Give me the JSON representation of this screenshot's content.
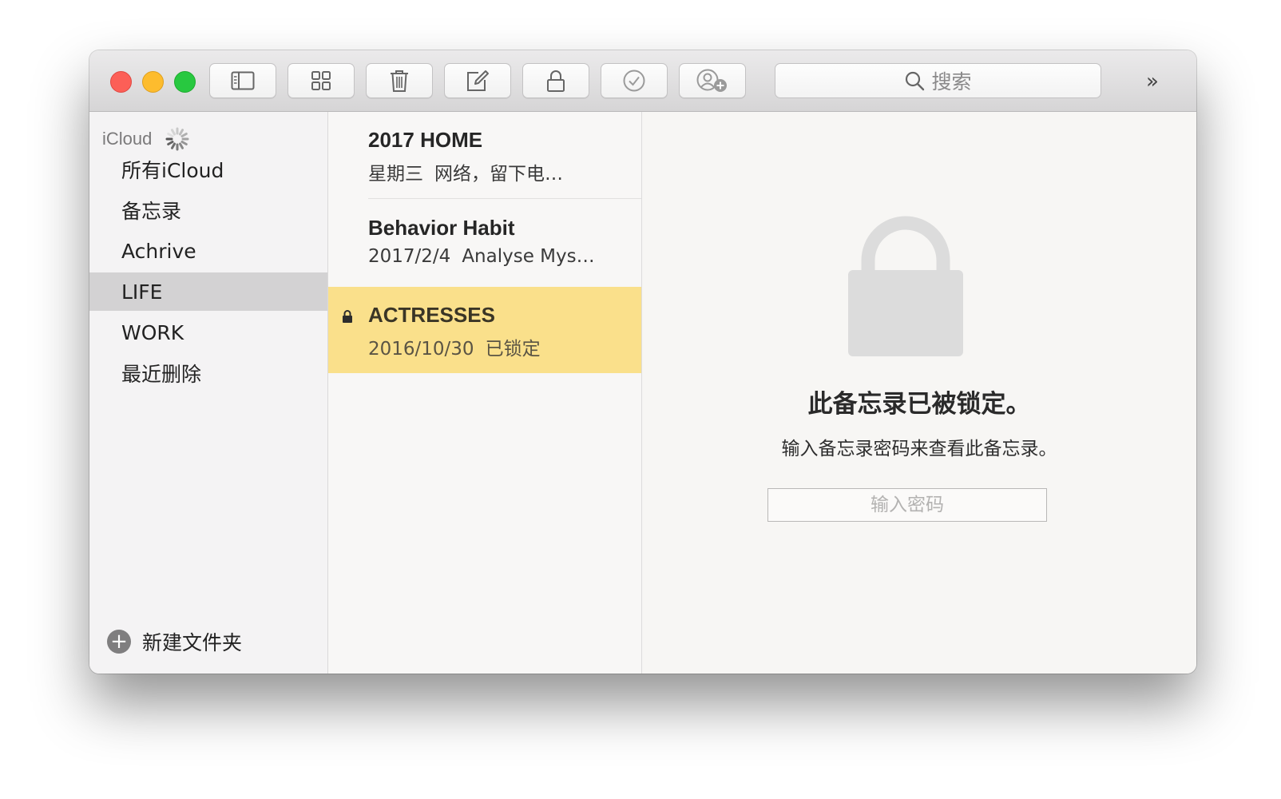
{
  "toolbar": {
    "buttons": [
      {
        "name": "sidebar-toggle",
        "icon": "sidebar-icon"
      },
      {
        "name": "attachments-browser",
        "icon": "grid-icon"
      },
      {
        "name": "delete",
        "icon": "trash-icon"
      },
      {
        "name": "new-note",
        "icon": "compose-icon"
      },
      {
        "name": "lock-note",
        "icon": "lock-icon"
      },
      {
        "name": "checklist",
        "icon": "checkmark-circle-icon"
      },
      {
        "name": "add-people",
        "icon": "add-person-icon"
      }
    ],
    "search_placeholder": "搜索",
    "overflow_label": "»"
  },
  "sidebar": {
    "account": "iCloud",
    "folders": [
      {
        "label": "所有iCloud",
        "selected": false
      },
      {
        "label": "备忘录",
        "selected": false
      },
      {
        "label": "Achrive",
        "selected": false
      },
      {
        "label": "LIFE",
        "selected": true
      },
      {
        "label": "WORK",
        "selected": false
      },
      {
        "label": "最近删除",
        "selected": false
      }
    ],
    "new_folder_label": "新建文件夹"
  },
  "notes": [
    {
      "title": "2017 HOME",
      "date": "星期三",
      "preview": "网络，留下电…",
      "locked": false,
      "selected": false
    },
    {
      "title": "Behavior Habit",
      "date": "2017/2/4",
      "preview": "Analyse Mys…",
      "locked": false,
      "selected": false
    },
    {
      "title": "ACTRESSES",
      "date": "2016/10/30",
      "preview": "已锁定",
      "locked": true,
      "selected": true
    }
  ],
  "detail": {
    "locked_title": "此备忘录已被锁定。",
    "locked_message": "输入备忘录密码来查看此备忘录。",
    "password_placeholder": "输入密码"
  },
  "colors": {
    "selected_note": "#fae08b",
    "selected_folder": "#d3d2d3",
    "close": "#fc5f57",
    "minimize": "#fdbc2e",
    "zoom": "#28c840"
  }
}
